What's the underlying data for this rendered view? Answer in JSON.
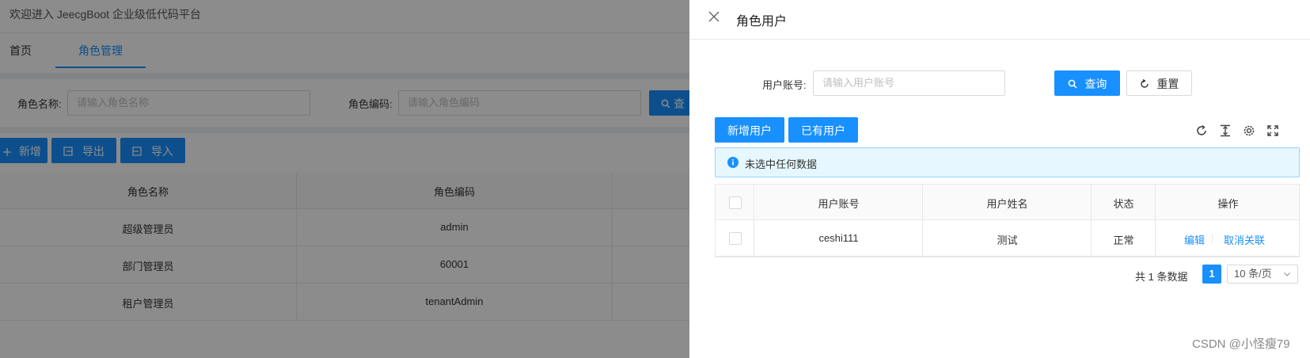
{
  "background": {
    "welcome_text": "欢迎进入 JeecgBoot 企业级低代码平台",
    "tabs": [
      {
        "label": "首页",
        "active": false
      },
      {
        "label": "角色管理",
        "active": true
      }
    ],
    "search": {
      "role_name_label": "角色名称:",
      "role_name_placeholder": "请输入角色名称",
      "role_code_label": "角色编码:",
      "role_code_placeholder": "请输入角色编码",
      "query_label": "查"
    },
    "toolbar": {
      "add_label": "新增",
      "export_label": "导出",
      "import_label": "导入"
    },
    "table": {
      "headers": [
        "角色名称",
        "角色编码"
      ],
      "rows": [
        [
          "超级管理员",
          "admin"
        ],
        [
          "部门管理员",
          "60001"
        ],
        [
          "租户管理员",
          "tenantAdmin"
        ]
      ]
    }
  },
  "drawer": {
    "title": "角色用户",
    "search": {
      "account_label": "用户账号:",
      "account_placeholder": "请输入用户账号",
      "query_label": "查询",
      "reset_label": "重置"
    },
    "buttons": {
      "add_user": "新增用户",
      "existing_user": "已有用户"
    },
    "alert_text": "未选中任何数据",
    "table": {
      "headers": [
        "用户账号",
        "用户姓名",
        "状态",
        "操作"
      ],
      "rows": [
        {
          "account": "ceshi111",
          "name": "测试",
          "status": "正常",
          "edit": "编辑",
          "unlink": "取消关联"
        }
      ]
    },
    "pagination": {
      "total_text": "共 1 条数据",
      "current_page": "1",
      "page_size": "10 条/页"
    }
  },
  "watermark": "CSDN @小怪瘦79",
  "colors": {
    "primary": "#1890ff",
    "overlay": "rgba(0,0,0,0.45)"
  }
}
